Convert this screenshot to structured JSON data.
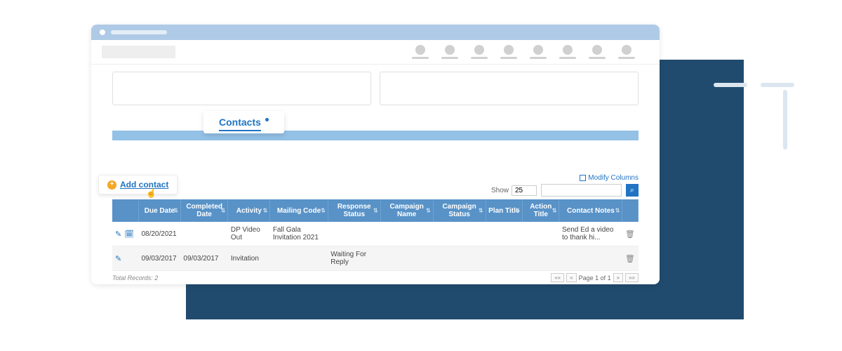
{
  "tab": {
    "label": "Contacts"
  },
  "add_contact": {
    "label": "Add contact"
  },
  "controls": {
    "modify_columns": "Modify Columns",
    "show_label": "Show",
    "show_value": "25",
    "search_placeholder": ""
  },
  "columns": [
    "",
    "Due Date",
    "Completed Date",
    "Activity",
    "Mailing Code",
    "Response Status",
    "Campaign Name",
    "Campaign Status",
    "Plan Title",
    "Action Title",
    "Contact Notes",
    ""
  ],
  "rows": [
    {
      "due_date": "08/20/2021",
      "completed_date": "",
      "activity": "DP Video Out",
      "mailing_code": "Fall Gala Invitation 2021",
      "response_status": "",
      "campaign_name": "",
      "campaign_status": "",
      "plan_title": "",
      "action_title": "",
      "contact_notes": "Send Ed a video to thank hi...",
      "has_cal": true
    },
    {
      "due_date": "09/03/2017",
      "completed_date": "09/03/2017",
      "activity": "Invitation",
      "mailing_code": "",
      "response_status": "Waiting For Reply",
      "campaign_name": "",
      "campaign_status": "",
      "plan_title": "",
      "action_title": "",
      "contact_notes": "",
      "has_cal": false
    }
  ],
  "footer": {
    "total": "Total Records: 2",
    "page": "Page 1 of 1"
  }
}
